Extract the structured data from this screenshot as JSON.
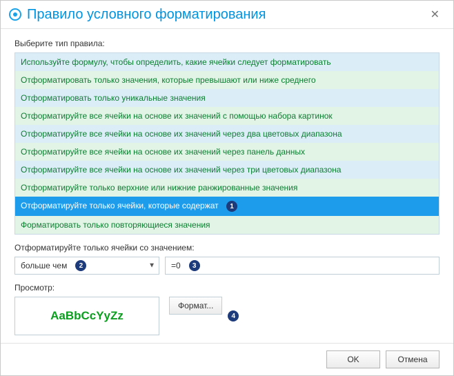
{
  "window": {
    "title": "Правило условного форматирования"
  },
  "labels": {
    "select_rule_type": "Выберите тип правила:",
    "format_cells_with_value": "Отформатируйте только ячейки со значением:",
    "preview": "Просмотр:"
  },
  "rules": [
    "Используйте формулу, чтобы определить, какие ячейки следует форматировать",
    "Отформатировать только значения, которые превышают или ниже среднего",
    "Отформатировать только уникальные значения",
    "Отформатируйте все ячейки на основе их значений с помощью набора картинок",
    "Отформатируйте все ячейки на основе их значений через два цветовых диапазона",
    "Отформатируйте все ячейки на основе их значений через панель данных",
    "Отформатируйте все ячейки на основе их значений через три цветовых диапазона",
    "Отформатируйте только верхние или нижние ранжированные значения",
    "Отформатируйте только ячейки, которые содержат",
    "Форматировать только повторяющиеся значения"
  ],
  "selected_rule_index": 8,
  "condition": {
    "operator": "больше чем",
    "value": "=0"
  },
  "preview_sample": "AaBbCcYyZz",
  "buttons": {
    "format": "Формат...",
    "ok": "OK",
    "cancel": "Отмена"
  },
  "markers": {
    "1": "1",
    "2": "2",
    "3": "3",
    "4": "4"
  }
}
